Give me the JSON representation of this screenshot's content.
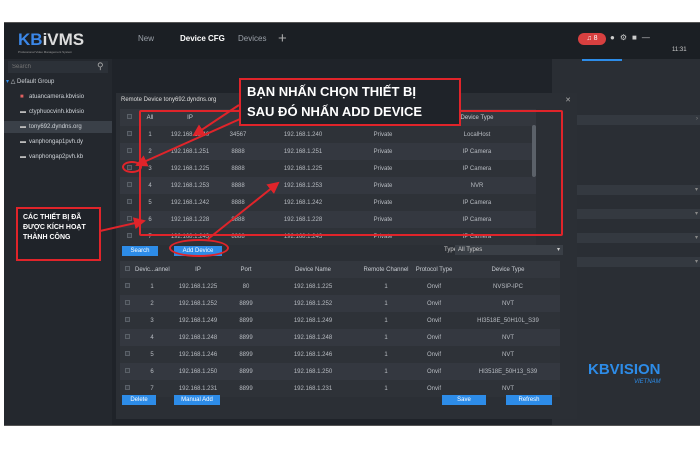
{
  "app": {
    "logo": "KBiVMS",
    "logo_prefix": "KB",
    "logo_suffix": "iVMS",
    "logo_sub": "Professional Video Management System",
    "tabs": [
      "New",
      "Device CFG",
      "Devices"
    ],
    "active_tab": "Device CFG",
    "alarm_count": "8",
    "clock": "11:31"
  },
  "sidebar": {
    "search_placeholder": "Search",
    "root": "Default Group",
    "devices": [
      "atuancamera.kbvisio",
      "ctyphuocvinh.kbvisio",
      "tony692.dyndns.org",
      "vanphongap1pvh.dy",
      "vanphongap2pvh.kb"
    ],
    "selected": "tony692.dyndns.org"
  },
  "dialog": {
    "title": "Remote Device tony692.dyndns.org",
    "top_table": {
      "headers": [
        "All",
        "IP",
        "",
        "",
        "",
        "Device Type"
      ],
      "rows": [
        [
          "1",
          "192.168.1.240",
          "34567",
          "192.168.1.240",
          "Private",
          "LocalHost"
        ],
        [
          "2",
          "192.168.1.251",
          "8888",
          "192.168.1.251",
          "Private",
          "IP Camera"
        ],
        [
          "3",
          "192.168.1.225",
          "8888",
          "192.168.1.225",
          "Private",
          "IP Camera"
        ],
        [
          "4",
          "192.168.1.253",
          "8888",
          "192.168.1.253",
          "Private",
          "NVR"
        ],
        [
          "5",
          "192.168.1.242",
          "8888",
          "192.168.1.242",
          "Private",
          "IP Camera"
        ],
        [
          "6",
          "192.168.1.228",
          "8888",
          "192.168.1.228",
          "Private",
          "IP Camera"
        ],
        [
          "7",
          "192.168.1.243",
          "8888",
          "192.168.1.243",
          "Private",
          "IP Camera"
        ]
      ]
    },
    "search_btn": "Search",
    "add_btn": "Add Device",
    "type_label": "Type",
    "type_value": "All Types",
    "bottom_table": {
      "headers": [
        "Devic...annel",
        "IP",
        "Port",
        "Device Name",
        "Remote Channel",
        "Protocol Type",
        "Device Type"
      ],
      "rows": [
        [
          "1",
          "192.168.1.225",
          "80",
          "192.168.1.225",
          "1",
          "Onvif",
          "NVSIP-IPC"
        ],
        [
          "2",
          "192.168.1.252",
          "8899",
          "192.168.1.252",
          "1",
          "Onvif",
          "NVT"
        ],
        [
          "3",
          "192.168.1.249",
          "8899",
          "192.168.1.249",
          "1",
          "Onvif",
          "HI3518E_50H10L_S39"
        ],
        [
          "4",
          "192.168.1.248",
          "8899",
          "192.168.1.248",
          "1",
          "Onvif",
          "NVT"
        ],
        [
          "5",
          "192.168.1.246",
          "8899",
          "192.168.1.246",
          "1",
          "Onvif",
          "NVT"
        ],
        [
          "6",
          "192.168.1.250",
          "8899",
          "192.168.1.250",
          "1",
          "Onvif",
          "HI3518E_50H13_S39"
        ],
        [
          "7",
          "192.168.1.231",
          "8899",
          "192.168.1.231",
          "1",
          "Onvif",
          "NVT"
        ]
      ]
    },
    "delete_btn": "Delete",
    "manual_add_btn": "Manual Add",
    "save_btn": "Save",
    "refresh_btn": "Refresh"
  },
  "annotations": {
    "main_line1": "BẠN NHẤN CHỌN THIẾT BỊ",
    "main_line2": "SAU ĐÓ NHẤN ADD DEVICE",
    "side": "CÁC THIẾT BỊ ĐÃ ĐƯỢC KÍCH HOẠT THÀNH CÔNG"
  },
  "watermark": {
    "main": "KBVISION",
    "sub": "VIETNAM"
  },
  "colors": {
    "accent": "#2d8ce8",
    "annotation": "#e0242a",
    "background": "#1f2329"
  }
}
